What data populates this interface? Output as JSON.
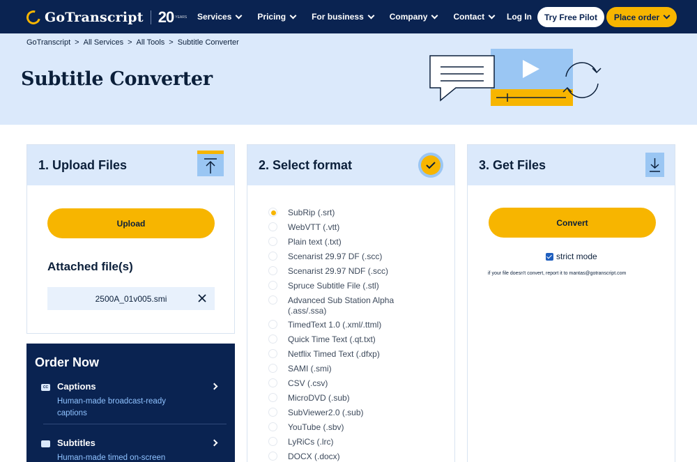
{
  "brand": {
    "name": "GoTranscript",
    "anniversary": "20",
    "anniversary_sub": "YEARS"
  },
  "nav": {
    "items": [
      {
        "label": "Services"
      },
      {
        "label": "Pricing"
      },
      {
        "label": "For business"
      },
      {
        "label": "Company"
      },
      {
        "label": "Contact"
      }
    ],
    "login": "Log In",
    "pilot": "Try Free Pilot",
    "order": "Place order"
  },
  "breadcrumb": [
    "GoTranscript",
    "All Services",
    "All Tools",
    "Subtitle Converter"
  ],
  "breadcrumb_sep": ">",
  "page_title": "Subtitle Converter",
  "step1": {
    "title": "1. Upload Files",
    "upload_label": "Upload",
    "attached_title": "Attached file(s)",
    "file_name": "2500A_01v005.smi"
  },
  "step2": {
    "title": "2. Select format",
    "selected_index": 0,
    "formats": [
      "SubRip (.srt)",
      "WebVTT (.vtt)",
      "Plain text (.txt)",
      "Scenarist 29.97 DF (.scc)",
      "Scenarist 29.97 NDF (.scc)",
      "Spruce Subtitle File (.stl)",
      "Advanced Sub Station Alpha (.ass/.ssa)",
      "TimedText 1.0 (.xml/.ttml)",
      "Quick Time Text (.qt.txt)",
      "Netflix Timed Text (.dfxp)",
      "SAMI (.smi)",
      "CSV (.csv)",
      "MicroDVD (.sub)",
      "SubViewer2.0 (.sub)",
      "YouTube (.sbv)",
      "LyRiCs (.lrc)",
      "DOCX (.docx)"
    ]
  },
  "step3": {
    "title": "3. Get Files",
    "convert_label": "Convert",
    "strict_label": "strict mode",
    "strict_checked": true,
    "note": "if your file doesn't convert, report it to mantas@gotranscript.com"
  },
  "order_now": {
    "title": "Order Now",
    "items": [
      {
        "title": "Captions",
        "desc": "Human-made broadcast-ready captions",
        "icon": "cc-icon",
        "icon_text": "CC"
      },
      {
        "title": "Subtitles",
        "desc": "Human-made timed on-screen",
        "icon": "subtitles-icon",
        "icon_text": ""
      }
    ]
  },
  "colors": {
    "navy": "#0a2351",
    "yellow": "#f7b500",
    "light_blue": "#dbe9fb",
    "mid_blue": "#9ac6f3"
  }
}
